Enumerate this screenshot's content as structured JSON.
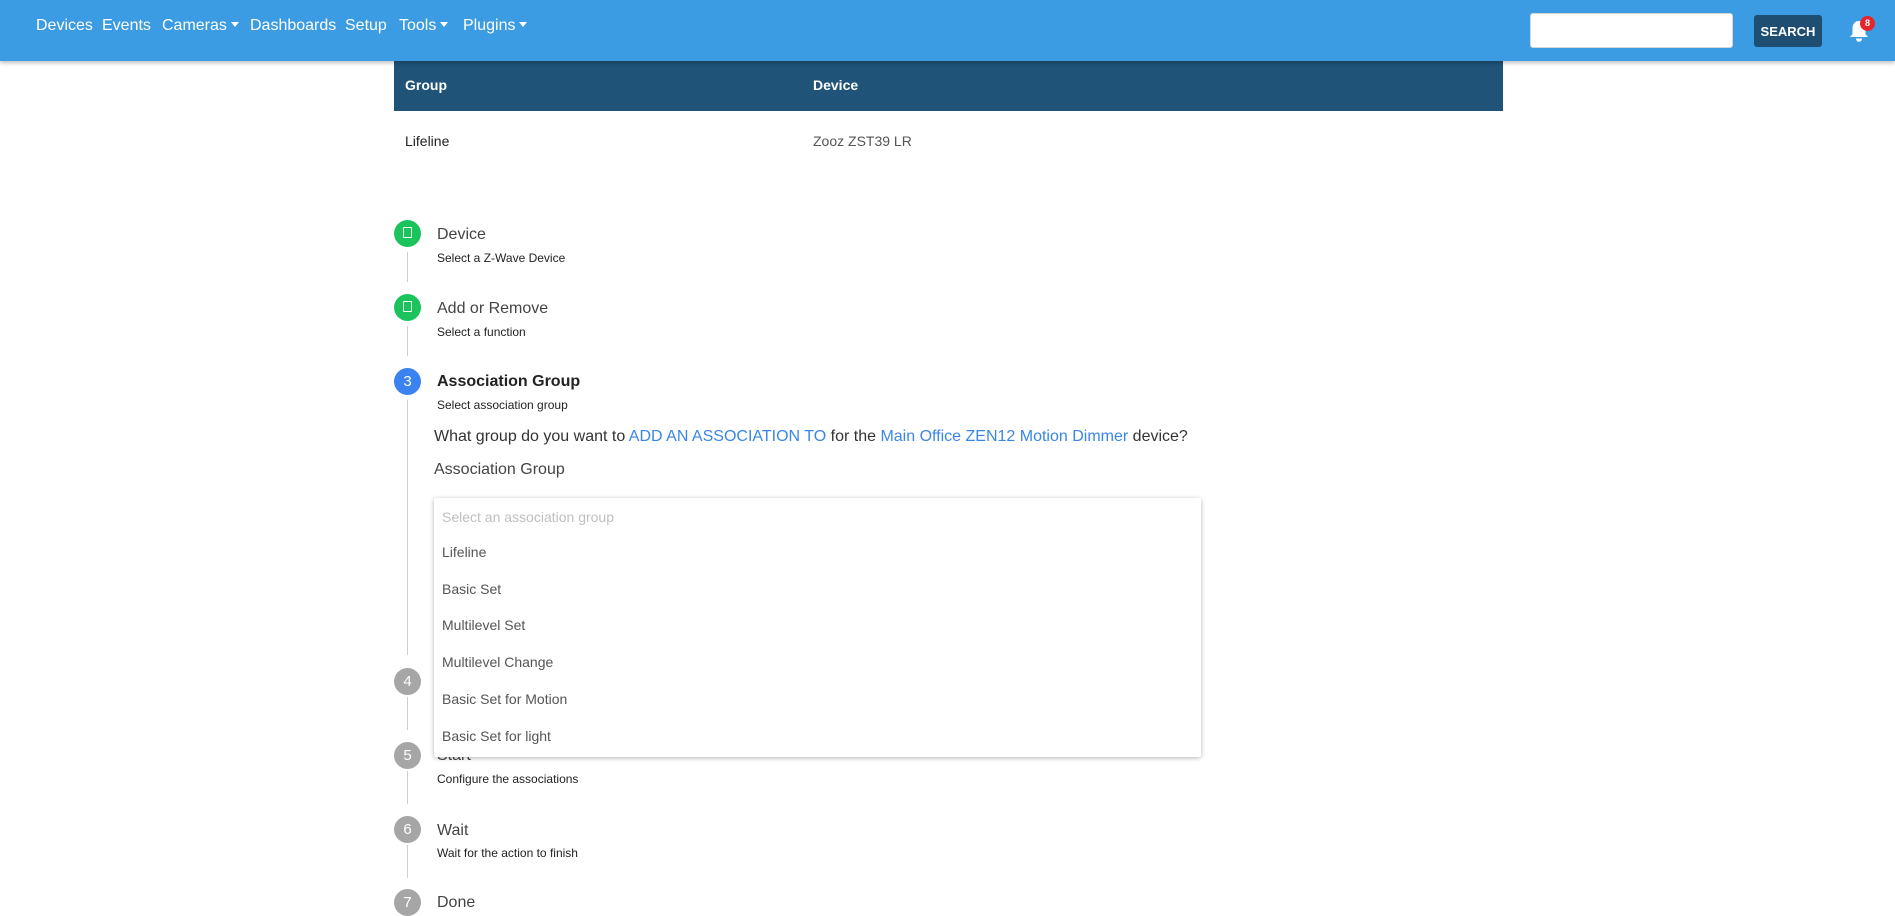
{
  "nav": {
    "items": [
      {
        "label": "Devices",
        "dropdown": false
      },
      {
        "label": "Events",
        "dropdown": false
      },
      {
        "label": "Cameras",
        "dropdown": true
      },
      {
        "label": "Dashboards",
        "dropdown": false
      },
      {
        "label": "Setup",
        "dropdown": false
      },
      {
        "label": "Tools",
        "dropdown": true
      },
      {
        "label": "Plugins",
        "dropdown": true
      }
    ],
    "search_value": "",
    "search_button": "SEARCH",
    "notification_count": "8",
    "bar_color": "#3b9be3"
  },
  "table": {
    "headers": [
      "Group",
      "Device"
    ],
    "rows": [
      {
        "group": "Lifeline",
        "device": "Zooz ZST39 LR"
      }
    ],
    "header_color": "#1f5377"
  },
  "steps": [
    {
      "number": "",
      "title": "Device",
      "subtitle": "Select a Z-Wave Device",
      "status": "complete"
    },
    {
      "number": "",
      "title": "Add or Remove",
      "subtitle": "Select a function",
      "status": "complete"
    },
    {
      "number": "3",
      "title": "Association Group",
      "subtitle": "Select association group",
      "status": "active"
    },
    {
      "number": "4",
      "title": "",
      "subtitle": "",
      "status": "pending"
    },
    {
      "number": "5",
      "title": "Start",
      "subtitle": "Configure the associations",
      "status": "pending"
    },
    {
      "number": "6",
      "title": "Wait",
      "subtitle": "Wait for the action to finish",
      "status": "pending"
    },
    {
      "number": "7",
      "title": "Done",
      "subtitle": "",
      "status": "pending"
    }
  ],
  "question": {
    "prefix": "What group do you want to ",
    "action": "ADD AN ASSOCIATION TO",
    "middle": " for the ",
    "device": "Main Office ZEN12 Motion Dimmer",
    "suffix": " device?"
  },
  "association": {
    "label": "Association Group",
    "placeholder": "Select an association group",
    "options": [
      "Lifeline",
      "Basic Set",
      "Multilevel Set",
      "Multilevel Change",
      "Basic Set for Motion",
      "Basic Set for light"
    ]
  },
  "colors": {
    "complete": "#1bc35d",
    "active": "#3a82f0",
    "pending": "#a6a6a6",
    "link": "#3a86e8"
  },
  "icons": {
    "complete_step": "check-icon",
    "notifications": "bell-icon",
    "dropdown": "caret-down-icon"
  }
}
